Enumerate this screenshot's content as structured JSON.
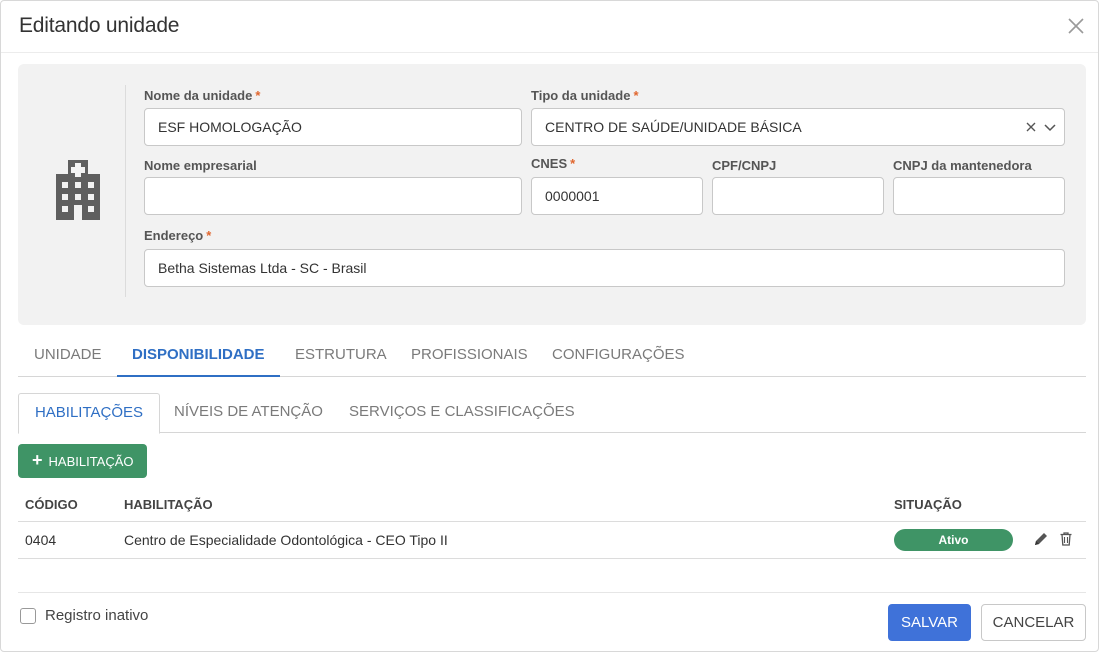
{
  "dialog": {
    "title": "Editando unidade"
  },
  "form": {
    "nome_unidade": {
      "label": "Nome da unidade",
      "required": "*",
      "value": "ESF HOMOLOGAÇÃO"
    },
    "tipo_unidade": {
      "label": "Tipo da unidade",
      "required": "*",
      "value": "CENTRO DE SAÚDE/UNIDADE BÁSICA"
    },
    "nome_empresarial": {
      "label": "Nome empresarial",
      "value": ""
    },
    "cnes": {
      "label": "CNES",
      "required": "*",
      "value": "0000001"
    },
    "cpf_cnpj": {
      "label": "CPF/CNPJ",
      "value": ""
    },
    "cnpj_mantenedora": {
      "label": "CNPJ da mantenedora",
      "value": ""
    },
    "endereco": {
      "label": "Endereço",
      "required": "*",
      "value": "Betha Sistemas Ltda - SC - Brasil"
    }
  },
  "tabs": [
    "UNIDADE",
    "DISPONIBILIDADE",
    "ESTRUTURA",
    "PROFISSIONAIS",
    "CONFIGURAÇÕES"
  ],
  "active_tab": "DISPONIBILIDADE",
  "subtabs": [
    "HABILITAÇÕES",
    "NÍVEIS DE ATENÇÃO",
    "SERVIÇOS E CLASSIFICAÇÕES"
  ],
  "active_subtab": "HABILITAÇÕES",
  "add_button": {
    "label": "HABILITAÇÃO"
  },
  "table": {
    "headers": [
      "CÓDIGO",
      "HABILITAÇÃO",
      "SITUAÇÃO"
    ],
    "rows": [
      {
        "codigo": "0404",
        "habilitacao": "Centro de Especialidade Odontológica - CEO Tipo II",
        "situacao": "Ativo"
      }
    ]
  },
  "footer": {
    "checkbox_label": "Registro inativo",
    "save_label": "SALVAR",
    "cancel_label": "CANCELAR"
  },
  "colors": {
    "primary": "#3f72d9",
    "tab_active": "#2f6fc4",
    "success": "#3f9466",
    "required": "#e0662e"
  }
}
